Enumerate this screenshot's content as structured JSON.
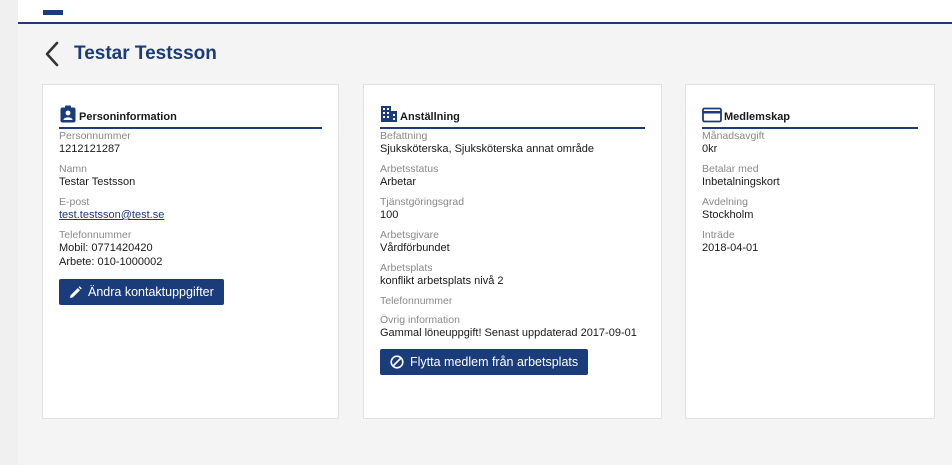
{
  "page": {
    "title": "Testar Testsson"
  },
  "person": {
    "title": "Personinformation",
    "fields": [
      {
        "label": "Personnummer",
        "value": "1212121287"
      },
      {
        "label": "Namn",
        "value": "Testar Testsson"
      },
      {
        "label": "E-post",
        "value": "test.testsson@test.se"
      },
      {
        "label": "Telefonnummer",
        "value": "Mobil: 0771420420",
        "value2": "Arbete: 010-1000002"
      }
    ],
    "button_label": "Ändra kontaktuppgifter"
  },
  "employment": {
    "title": "Anställning",
    "fields": [
      {
        "label": "Befattning",
        "value": "Sjuksköterska, Sjuksköterska annat område"
      },
      {
        "label": "Arbetsstatus",
        "value": "Arbetar"
      },
      {
        "label": "Tjänstgöringsgrad",
        "value": "100"
      },
      {
        "label": "Arbetsgivare",
        "value": "Vårdförbundet"
      },
      {
        "label": "Arbetsplats",
        "value": "konflikt arbetsplats nivå 2"
      },
      {
        "label": "Telefonnummer",
        "value": ""
      },
      {
        "label": "Övrig information",
        "value": "Gammal löneuppgift! Senast uppdaterad 2017-09-01"
      }
    ],
    "button_label": "Flytta medlem från arbetsplats"
  },
  "membership": {
    "title": "Medlemskap",
    "fields": [
      {
        "label": "Månadsavgift",
        "value": "0kr"
      },
      {
        "label": "Betalar med",
        "value": "Inbetalningskort"
      },
      {
        "label": "Avdelning",
        "value": "Stockholm"
      },
      {
        "label": "Inträde",
        "value": "2018-04-01"
      }
    ]
  },
  "colors": {
    "primary": "#1b3c7a",
    "label": "#8a8a8a",
    "background": "#f4f4f4"
  },
  "icons": {
    "back": "chevron-left-icon",
    "person": "id-badge-icon",
    "employment": "building-icon",
    "membership": "card-icon",
    "edit": "pencil-icon",
    "move": "no-entry-icon"
  }
}
